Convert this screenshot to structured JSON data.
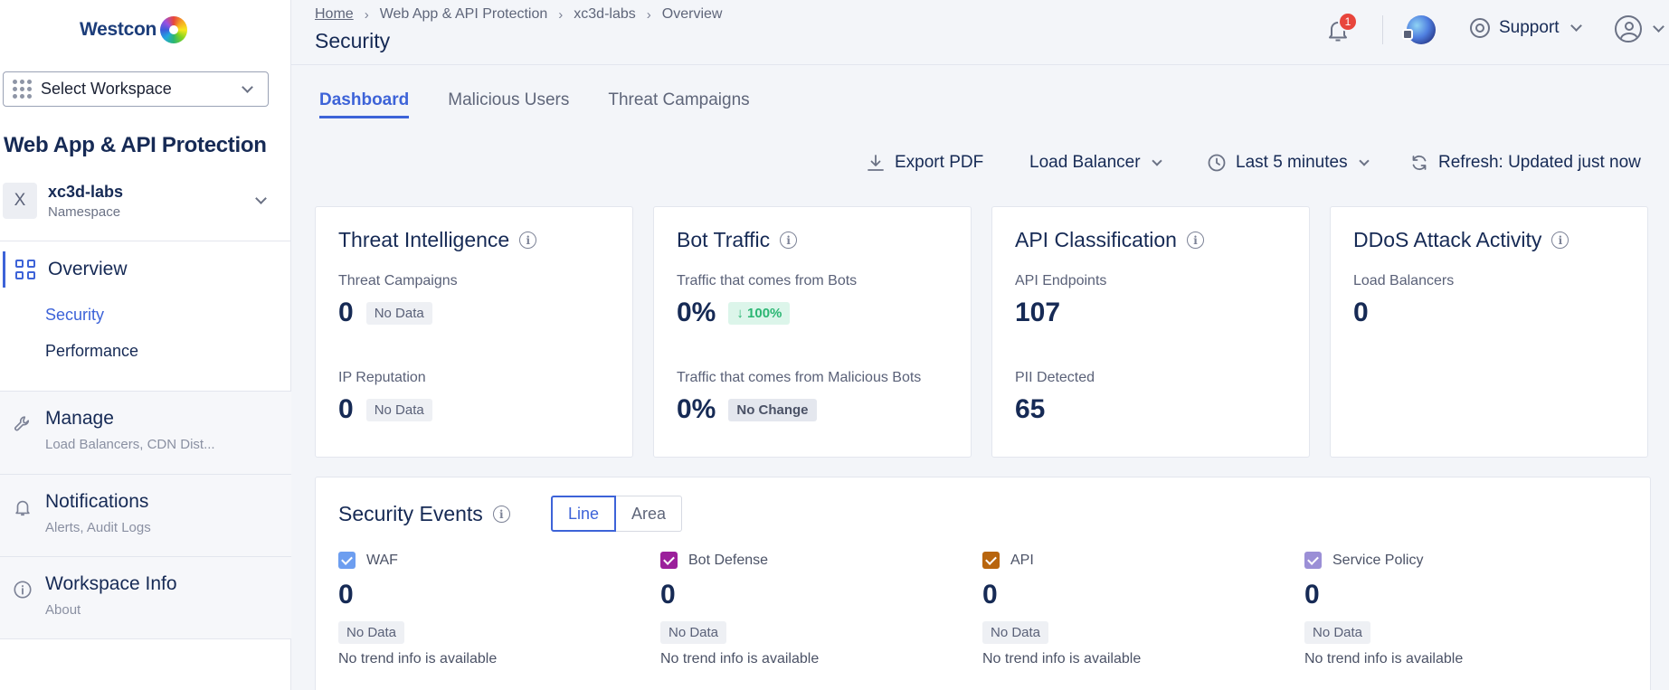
{
  "sidebar": {
    "brand": "Westcon",
    "workspace_select": "Select Workspace",
    "app_title": "Web App & API Protection",
    "namespace": {
      "avatar_letter": "X",
      "name": "xc3d-labs",
      "label": "Namespace"
    },
    "overview": {
      "label": "Overview",
      "sub_items": [
        "Security",
        "Performance"
      ]
    },
    "sections": [
      {
        "label": "Manage",
        "sub": "Load Balancers, CDN Dist...",
        "icon": "wrench-icon"
      },
      {
        "label": "Notifications",
        "sub": "Alerts, Audit Logs",
        "icon": "bell-icon"
      },
      {
        "label": "Workspace Info",
        "sub": "About",
        "icon": "info-icon"
      }
    ]
  },
  "header": {
    "breadcrumb": [
      "Home",
      "Web App & API Protection",
      "xc3d-labs",
      "Overview"
    ],
    "page_title": "Security",
    "notification_count": "1",
    "support_label": "Support"
  },
  "tabs": [
    "Dashboard",
    "Malicious Users",
    "Threat Campaigns"
  ],
  "toolbar": {
    "export": "Export PDF",
    "load_balancer": "Load Balancer",
    "time_range": "Last 5 minutes",
    "refresh": "Refresh: Updated just now"
  },
  "cards": {
    "threat_intel": {
      "title": "Threat Intelligence",
      "m1_label": "Threat Campaigns",
      "m1_value": "0",
      "m1_badge": "No Data",
      "m2_label": "IP Reputation",
      "m2_value": "0",
      "m2_badge": "No Data"
    },
    "bot_traffic": {
      "title": "Bot Traffic",
      "m1_label": "Traffic that comes from Bots",
      "m1_value": "0%",
      "m1_badge": "100%",
      "m2_label": "Traffic that comes from Malicious Bots",
      "m2_value": "0%",
      "m2_badge": "No Change"
    },
    "api_class": {
      "title": "API Classification",
      "m1_label": "API Endpoints",
      "m1_value": "107",
      "m2_label": "PII Detected",
      "m2_value": "65"
    },
    "ddos": {
      "title": "DDoS Attack Activity",
      "m1_label": "Load Balancers",
      "m1_value": "0"
    }
  },
  "events": {
    "title": "Security Events",
    "toggle": [
      "Line",
      "Area"
    ],
    "items": [
      {
        "label": "WAF",
        "value": "0",
        "badge": "No Data",
        "trend": "No trend info is available",
        "color": "#6d9ef0"
      },
      {
        "label": "Bot Defense",
        "value": "0",
        "badge": "No Data",
        "trend": "No trend info is available",
        "color": "#9b1f9b"
      },
      {
        "label": "API",
        "value": "0",
        "badge": "No Data",
        "trend": "No trend info is available",
        "color": "#b8650e"
      },
      {
        "label": "Service Policy",
        "value": "0",
        "badge": "No Data",
        "trend": "No trend info is available",
        "color": "#9b8fd6"
      }
    ]
  },
  "colors": {
    "accent": "#3d63d8",
    "brand_text": "#1c3d7a",
    "positive": "#2bb673"
  }
}
